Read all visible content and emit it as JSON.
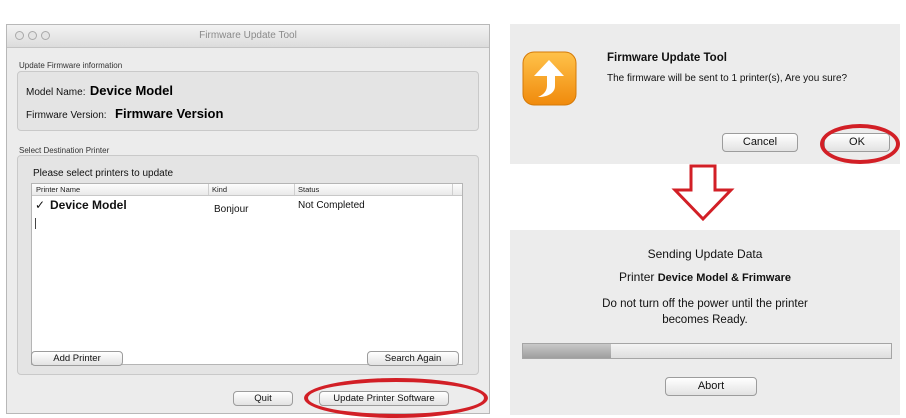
{
  "left_window": {
    "title": "Firmware Update Tool",
    "firmware_group_label": "Update Firmware information",
    "model_name_label": "Model Name:",
    "model_name_value": "Device Model",
    "firmware_version_label": "Firmware Version:",
    "firmware_version_value": "Firmware Version",
    "destination_group_label": "Select Destination Printer",
    "select_prompt": "Please select printers to update",
    "columns": [
      "Printer Name",
      "Kind",
      "Status"
    ],
    "rows": [
      {
        "checked": true,
        "check_mark": "✓",
        "name": "Device Model",
        "kind": "Bonjour",
        "status": "Not Completed"
      }
    ],
    "add_printer_button": "Add Printer",
    "search_again_button": "Search Again",
    "quit_button": "Quit",
    "update_button": "Update Printer Software"
  },
  "confirm_dialog": {
    "icon": "up-arrow-app-icon",
    "title": "Firmware Update Tool",
    "message": "The firmware will be sent to 1 printer(s), Are you sure?",
    "cancel_button": "Cancel",
    "ok_button": "OK"
  },
  "progress_dialog": {
    "heading": "Sending Update Data",
    "printer_prefix": "Printer",
    "printer_value": "Device Model & Frimware",
    "warning": "Do not turn off the power until the printer becomes Ready.",
    "progress_fraction": 0.24,
    "abort_button": "Abort"
  },
  "annotations": {
    "highlight_color": "#d21f26",
    "arrow_icon": "down-arrow-icon"
  }
}
